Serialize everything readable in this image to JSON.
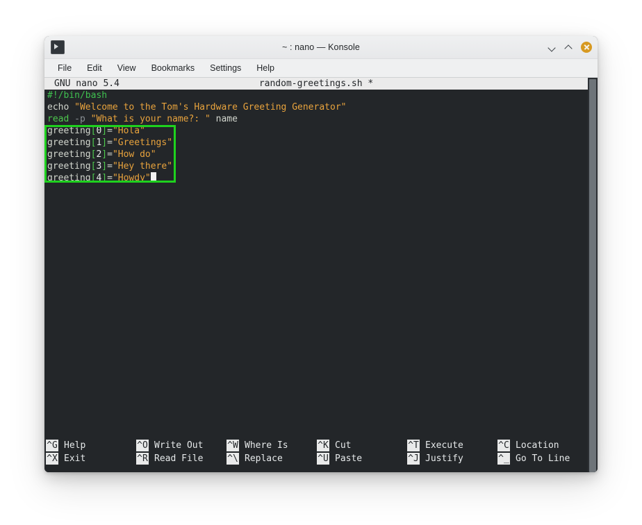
{
  "window": {
    "title": "~ : nano — Konsole",
    "app_icon": "terminal-prompt-icon",
    "controls": {
      "minimize": "minimize-chevron-icon",
      "maximize": "maximize-chevron-icon",
      "close": "close-button",
      "close_color": "#d79921"
    }
  },
  "menubar": {
    "items": [
      {
        "label": "File"
      },
      {
        "label": "Edit"
      },
      {
        "label": "View"
      },
      {
        "label": "Bookmarks"
      },
      {
        "label": "Settings"
      },
      {
        "label": "Help"
      }
    ]
  },
  "nano": {
    "version_label": "GNU nano 5.4",
    "filename": "random-greetings.sh *",
    "lines": [
      {
        "id": "shebang",
        "tokens": [
          {
            "text": "#!/bin/bash",
            "type": "comment"
          }
        ]
      },
      {
        "id": "echo-welcome",
        "tokens": [
          {
            "text": "echo ",
            "type": "plain"
          },
          {
            "text": "\"Welcome to the Tom's Hardware Greeting Generator\"",
            "type": "str"
          }
        ]
      },
      {
        "id": "read-name",
        "tokens": [
          {
            "text": "read",
            "type": "kw"
          },
          {
            "text": " -p ",
            "type": "dim"
          },
          {
            "text": "\"What is your name?: \"",
            "type": "str"
          },
          {
            "text": " name",
            "type": "plain"
          }
        ]
      },
      {
        "id": "greeting-0",
        "tokens": [
          {
            "text": "greeting",
            "type": "plain"
          },
          {
            "text": "[",
            "type": "brk"
          },
          {
            "text": "0",
            "type": "idx"
          },
          {
            "text": "]",
            "type": "brk"
          },
          {
            "text": "=",
            "type": "op"
          },
          {
            "text": "\"Hola\"",
            "type": "str"
          }
        ]
      },
      {
        "id": "greeting-1",
        "tokens": [
          {
            "text": "greeting",
            "type": "plain"
          },
          {
            "text": "[",
            "type": "brk"
          },
          {
            "text": "1",
            "type": "idx"
          },
          {
            "text": "]",
            "type": "brk"
          },
          {
            "text": "=",
            "type": "op"
          },
          {
            "text": "\"Greetings\"",
            "type": "str"
          }
        ]
      },
      {
        "id": "greeting-2",
        "tokens": [
          {
            "text": "greeting",
            "type": "plain"
          },
          {
            "text": "[",
            "type": "brk"
          },
          {
            "text": "2",
            "type": "idx"
          },
          {
            "text": "]",
            "type": "brk"
          },
          {
            "text": "=",
            "type": "op"
          },
          {
            "text": "\"How do\"",
            "type": "str"
          }
        ]
      },
      {
        "id": "greeting-3",
        "tokens": [
          {
            "text": "greeting",
            "type": "plain"
          },
          {
            "text": "[",
            "type": "brk"
          },
          {
            "text": "3",
            "type": "idx"
          },
          {
            "text": "]",
            "type": "brk"
          },
          {
            "text": "=",
            "type": "op"
          },
          {
            "text": "\"Hey there\"",
            "type": "str"
          }
        ]
      },
      {
        "id": "greeting-4",
        "tokens": [
          {
            "text": "greeting",
            "type": "plain"
          },
          {
            "text": "[",
            "type": "brk"
          },
          {
            "text": "4",
            "type": "idx"
          },
          {
            "text": "]",
            "type": "brk"
          },
          {
            "text": "=",
            "type": "op"
          },
          {
            "text": "\"Howdy\"",
            "type": "str"
          }
        ],
        "cursor": true
      }
    ],
    "shortcuts_row1": [
      {
        "key": "^G",
        "label": "Help"
      },
      {
        "key": "^O",
        "label": "Write Out"
      },
      {
        "key": "^W",
        "label": "Where Is"
      },
      {
        "key": "^K",
        "label": "Cut"
      },
      {
        "key": "^T",
        "label": "Execute"
      },
      {
        "key": "^C",
        "label": "Location"
      }
    ],
    "shortcuts_row2": [
      {
        "key": "^X",
        "label": "Exit"
      },
      {
        "key": "^R",
        "label": "Read File"
      },
      {
        "key": "^\\",
        "label": "Replace"
      },
      {
        "key": "^U",
        "label": "Paste"
      },
      {
        "key": "^J",
        "label": "Justify"
      },
      {
        "key": "^_",
        "label": "Go To Line"
      }
    ]
  },
  "annotation": {
    "type": "green-highlight-rectangle",
    "color": "#1ed11e",
    "covers": "greeting array assignment lines"
  },
  "colors": {
    "terminal_background": "#232629",
    "comment": "#3fc14f",
    "keyword": "#4ec94e",
    "string": "#e8a33d",
    "plain_text": "#d3d7cf",
    "nano_header_background": "#ebebeb",
    "annotation": "#1ed11e"
  }
}
